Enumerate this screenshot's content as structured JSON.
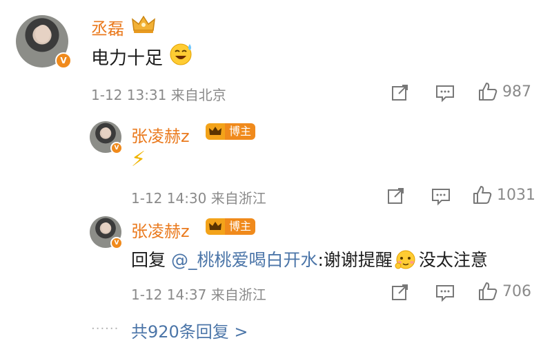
{
  "comment": {
    "author": "丞磊",
    "text": "电力十足",
    "meta": "1-12 13:31 来自北京",
    "likes": "987",
    "verified_badge": "V",
    "emoji": "grinning-sweat-emoji"
  },
  "replies": [
    {
      "author": "张凌赫z",
      "badge": "博主",
      "text": "⚡",
      "meta": "1-12 14:30 来自浙江",
      "likes": "1031"
    },
    {
      "author": "张凌赫z",
      "badge": "博主",
      "prefix": "回复",
      "mention": "@_桃桃爱喝白开水",
      "text_before_emoji": ":谢谢提醒",
      "text_after_emoji": "没太注意",
      "meta": "1-12 14:37 来自浙江",
      "likes": "706"
    }
  ],
  "more_replies": {
    "dots": "......",
    "label": "共920条回复 >"
  },
  "colors": {
    "name": "#ea7a1e",
    "mention_link": "#4b75a8",
    "meta": "#8a8a8a",
    "badge_orange": "#f08a1c"
  }
}
